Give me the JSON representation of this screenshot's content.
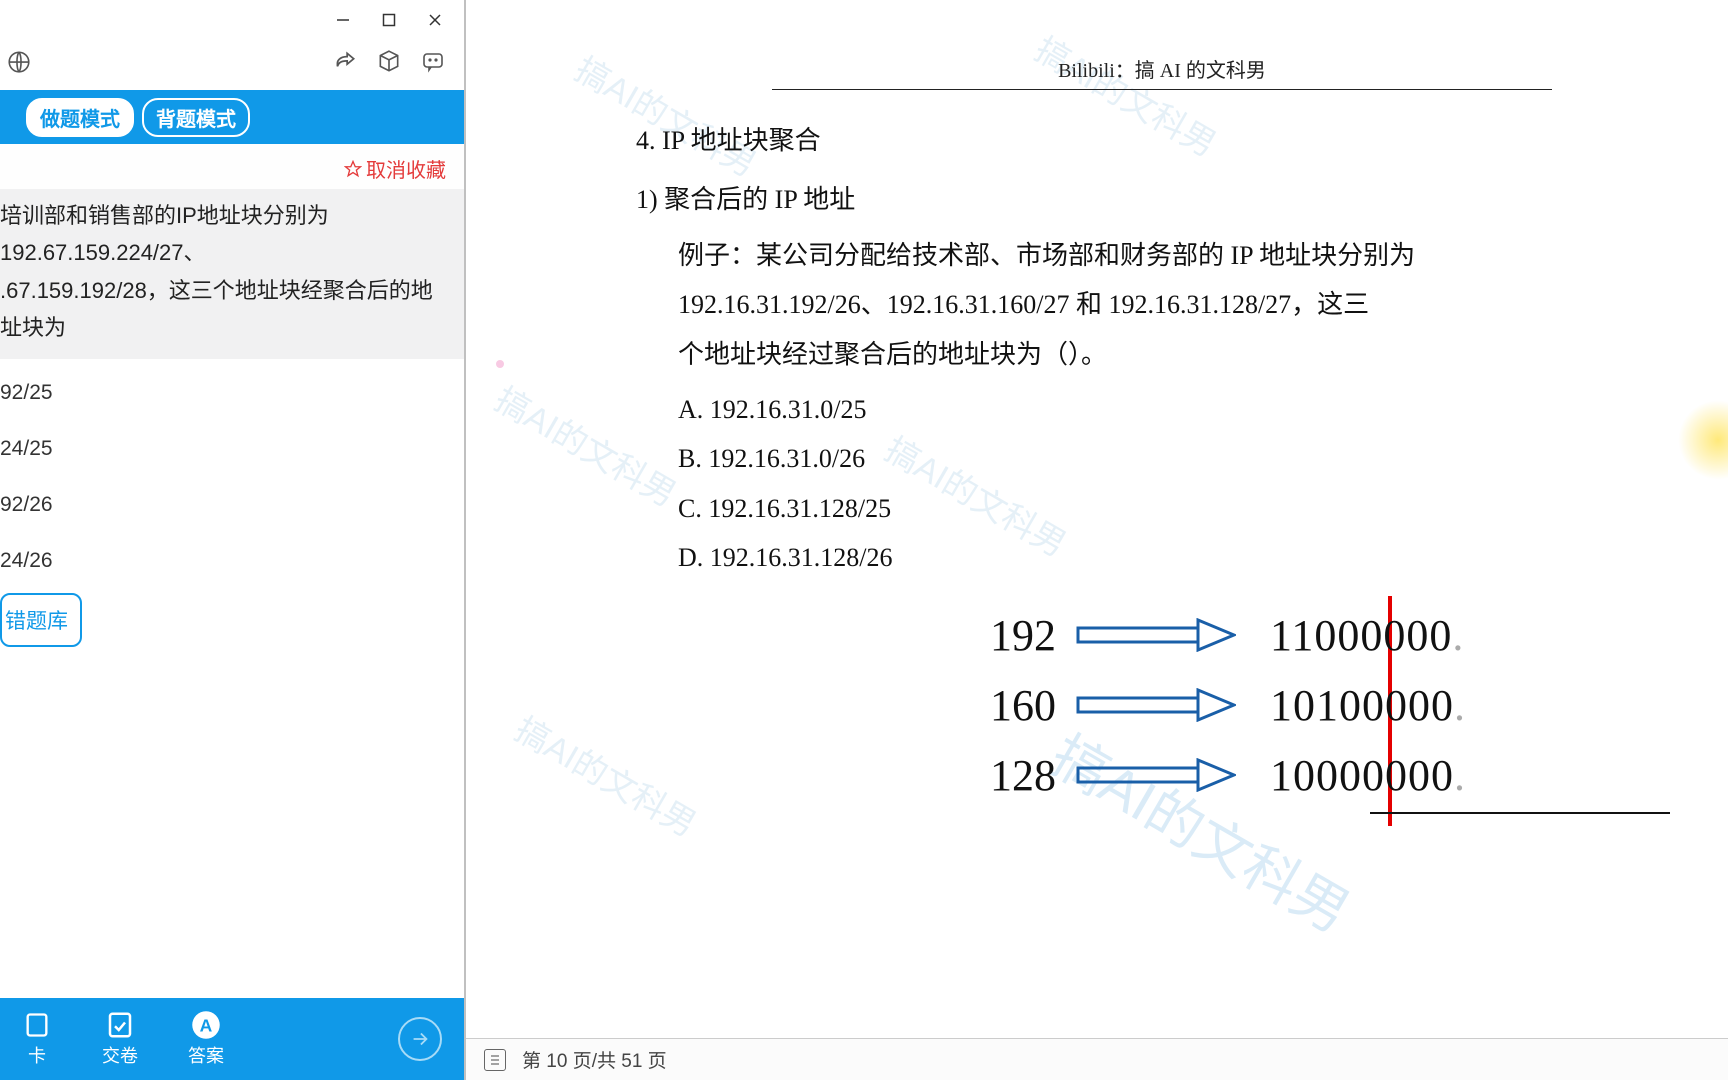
{
  "window_controls": {
    "minimize": "—",
    "maximize": "□",
    "close": "✕"
  },
  "mode_bar": {
    "active_label": "做题模式",
    "inactive_label": "背题模式"
  },
  "favorite": {
    "label": "取消收藏"
  },
  "question": {
    "line1": "培训部和销售部的IP地址块分别为192.67.159.224/27、",
    "line2": ".67.159.192/28，这三个地址块经聚合后的地址块为"
  },
  "options": [
    "92/25",
    "24/25",
    "92/26",
    "24/26"
  ],
  "wrong_button_label": "错题库",
  "bottom_nav": {
    "item1": "卡",
    "item2": "交卷",
    "item3": "答案"
  },
  "doc": {
    "header": "Bilibili：搞 AI 的文科男",
    "h4": "4. IP 地址块聚合",
    "h1_1": "1) 聚合后的 IP 地址",
    "ex_line1": "例子：某公司分配给技术部、市场部和财务部的 IP 地址块分别为",
    "ex_line2": "192.16.31.192/26、192.16.31.160/27 和 192.16.31.128/27，这三",
    "ex_line3": "个地址块经过聚合后的地址块为（）。",
    "opts": {
      "A": "A. 192.16.31.0/25",
      "B": "B. 192.16.31.0/26",
      "C": "C. 192.16.31.128/25",
      "D": "D. 192.16.31.128/26"
    }
  },
  "binary_rows": [
    {
      "dec": "192",
      "bits": "11000000"
    },
    {
      "dec": "160",
      "bits": "10100000"
    },
    {
      "dec": "128",
      "bits": "10000000"
    }
  ],
  "page_status": "第 10 页/共 51 页",
  "watermark": "搞AI的文科男"
}
